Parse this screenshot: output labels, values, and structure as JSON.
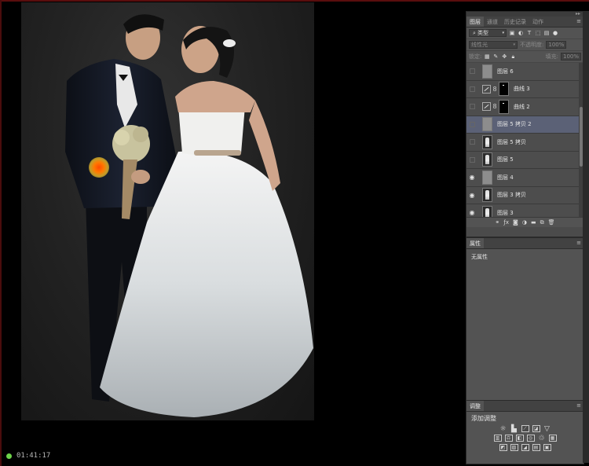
{
  "status": {
    "timer": "01:41:17"
  },
  "layers_panel": {
    "tabs": [
      {
        "label": "图层",
        "active": true
      },
      {
        "label": "通道",
        "active": false
      },
      {
        "label": "历史记录",
        "active": false
      },
      {
        "label": "动作",
        "active": false
      }
    ],
    "filter_kind": "类型",
    "blend_mode": "线性光",
    "opacity_label": "不透明度:",
    "opacity_value": "100%",
    "lock_label": "锁定:",
    "fill_label": "填充:",
    "fill_value": "100%",
    "layers": [
      {
        "name": "图层 6",
        "visible": false,
        "kind": "gray",
        "selected": false
      },
      {
        "name": "曲线 3",
        "visible": false,
        "kind": "curves",
        "selected": false
      },
      {
        "name": "曲线 2",
        "visible": false,
        "kind": "curves",
        "selected": false
      },
      {
        "name": "图层 5 拷贝 2",
        "visible": false,
        "kind": "gray",
        "selected": true
      },
      {
        "name": "图层 5 拷贝",
        "visible": false,
        "kind": "photo",
        "selected": false
      },
      {
        "name": "图层 5",
        "visible": false,
        "kind": "photo",
        "selected": false
      },
      {
        "name": "图层 4",
        "visible": true,
        "kind": "gray",
        "selected": false
      },
      {
        "name": "图层 3 拷贝",
        "visible": true,
        "kind": "photo",
        "selected": false
      },
      {
        "name": "图层 3",
        "visible": true,
        "kind": "photo",
        "selected": false
      }
    ]
  },
  "properties_panel": {
    "tab": "属性",
    "body": "无属性"
  },
  "adjustments_panel": {
    "tab": "调整",
    "title": "添加调整"
  }
}
